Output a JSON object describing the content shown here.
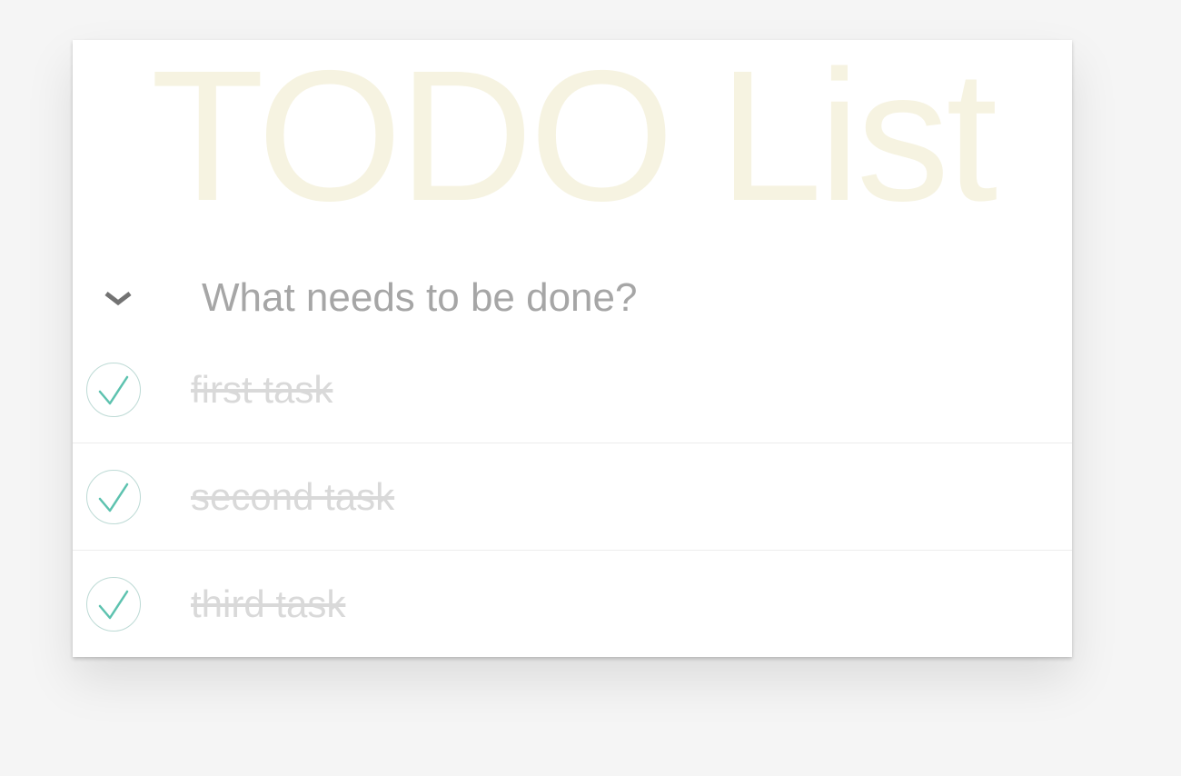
{
  "app": {
    "title": "TODO List"
  },
  "new_todo": {
    "placeholder": "What needs to be done?",
    "value": ""
  },
  "toggle_all": {
    "icon": "chevron-down-icon"
  },
  "todos": [
    {
      "label": "first task",
      "completed": true
    },
    {
      "label": "second task",
      "completed": true
    },
    {
      "label": "third task",
      "completed": true
    }
  ],
  "colors": {
    "title": "#efe9d2",
    "check": "#5dc2af",
    "check_ring": "#bddad5",
    "completed_text": "#d9d9d9",
    "placeholder": "#a6a6a6",
    "background": "#f5f5f5"
  }
}
